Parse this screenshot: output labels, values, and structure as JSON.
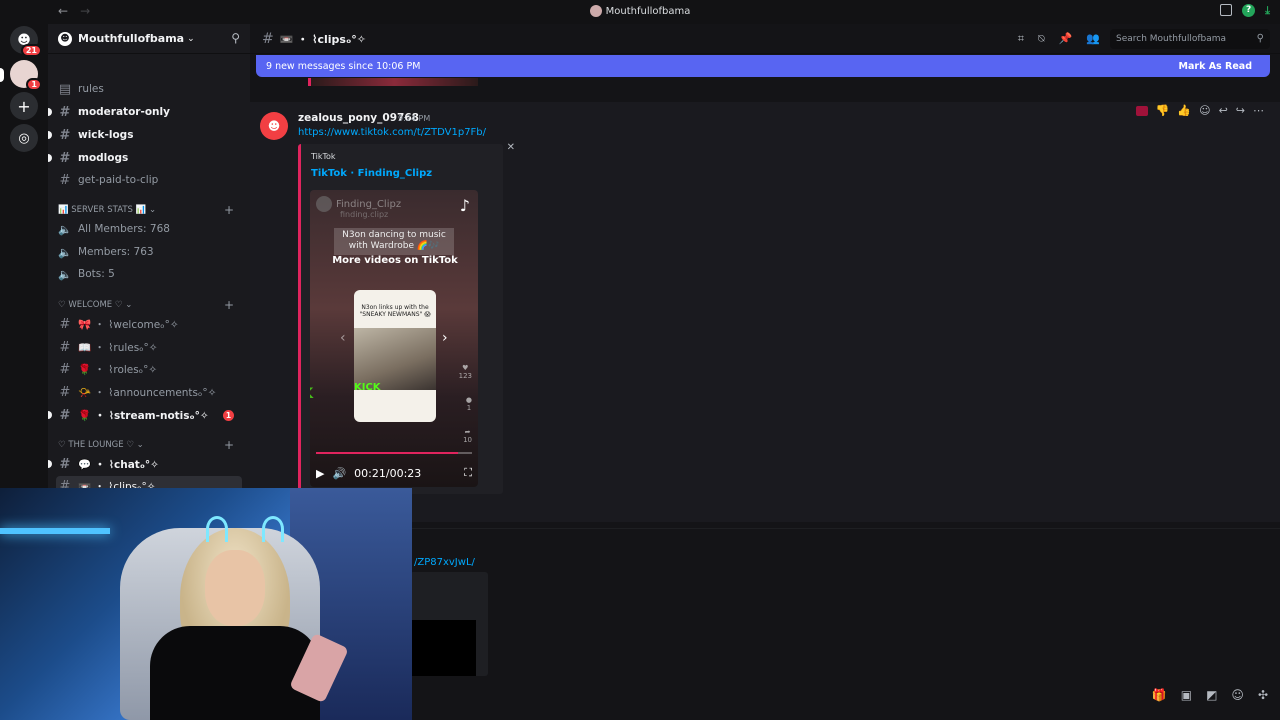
{
  "titlebar": {
    "title": "Mouthfullofbama",
    "back": "←",
    "forward": "→"
  },
  "servers": {
    "home_badge": "21",
    "selected_badge": "1"
  },
  "guild": {
    "name": "Mouthfullofbama"
  },
  "channels": {
    "rules": "rules",
    "moderator_only": "moderator-only",
    "wick_logs": "wick-logs",
    "modlogs": "modlogs",
    "get_paid": "get-paid-to-clip",
    "cat_server_stats": "📊 SERVER STATS 📊",
    "all_members": "All Members: 768",
    "members": "Members: 763",
    "bots": "Bots: 5",
    "cat_welcome": "♡ WELCOME ♡",
    "welcome": "🎀 ・ ⌇welcomeₒ°✧",
    "rules2": "📖 ・ ⌇rulesₒ°✧",
    "roles": "🌹 ・ ⌇rolesₒ°✧",
    "announcements": "📯 ・ ⌇announcementsₒ°✧",
    "stream_notis": "🌹 ・ ⌇stream-notisₒ°✧",
    "stream_notis_badge": "1",
    "cat_lounge": "♡ THE LOUNGE ♡",
    "chat": "💬 ・ ⌇chatₒ°✧",
    "clips": "📼 ・ ⌇clipsₒ°✧"
  },
  "header": {
    "channel": "📼 ・ ⌇clipsₒ°✧",
    "search_placeholder": "Search Mouthfullofbama"
  },
  "newbar": {
    "text": "9 new messages since 10:06 PM",
    "mark_read": "Mark As Read"
  },
  "message": {
    "username": "zealous_pony_09768",
    "timestamp": "9:24 PM",
    "link": "https://www.tiktok.com/t/ZTDV1p7Fb/",
    "embed": {
      "provider": "TikTok",
      "title": "TikTok · Finding_Clipz",
      "video": {
        "author": "Finding_Clipz",
        "handle": "finding.clipz",
        "caption": "N3on dancing to music with Wardrobe 🌈🎶",
        "more_videos": "More videos on TikTok",
        "thumb_caption": "N3on links up with the \"SNEAKY NEWMANS\" 😱",
        "kick": "KICK",
        "likes": "123",
        "comments": "1",
        "shares": "10",
        "time": "00:21/00:23",
        "progress": 0.913
      }
    }
  },
  "message2": {
    "link_tail": "/ZP87xvJwL/"
  }
}
